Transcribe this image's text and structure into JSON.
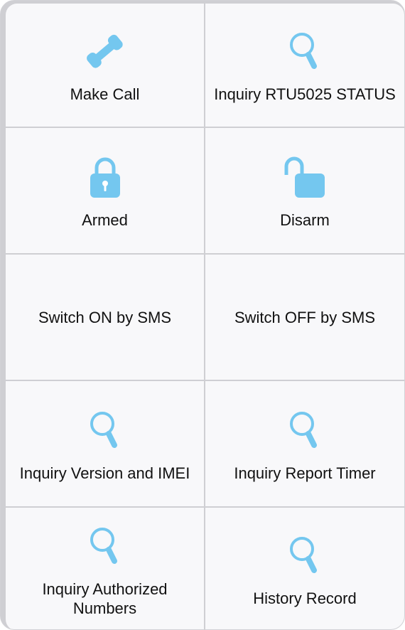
{
  "colors": {
    "icon": "#74c7ef",
    "divider": "#cfcfd3",
    "cell_bg": "#f8f8fa",
    "text": "#111111"
  },
  "menu": {
    "items": [
      {
        "label": "Make Call",
        "icon": "phone-icon"
      },
      {
        "label": "Inquiry RTU5025 STATUS",
        "icon": "magnifier-icon"
      },
      {
        "label": "Armed",
        "icon": "lock-closed-icon"
      },
      {
        "label": "Disarm",
        "icon": "lock-open-icon"
      },
      {
        "label": "Switch ON by SMS",
        "icon": ""
      },
      {
        "label": "Switch OFF by SMS",
        "icon": ""
      },
      {
        "label": "Inquiry Version and IMEI",
        "icon": "magnifier-icon"
      },
      {
        "label": "Inquiry Report Timer",
        "icon": "magnifier-icon"
      },
      {
        "label": "Inquiry Authorized Numbers",
        "icon": "magnifier-icon"
      },
      {
        "label": "History Record",
        "icon": "magnifier-icon"
      }
    ]
  }
}
